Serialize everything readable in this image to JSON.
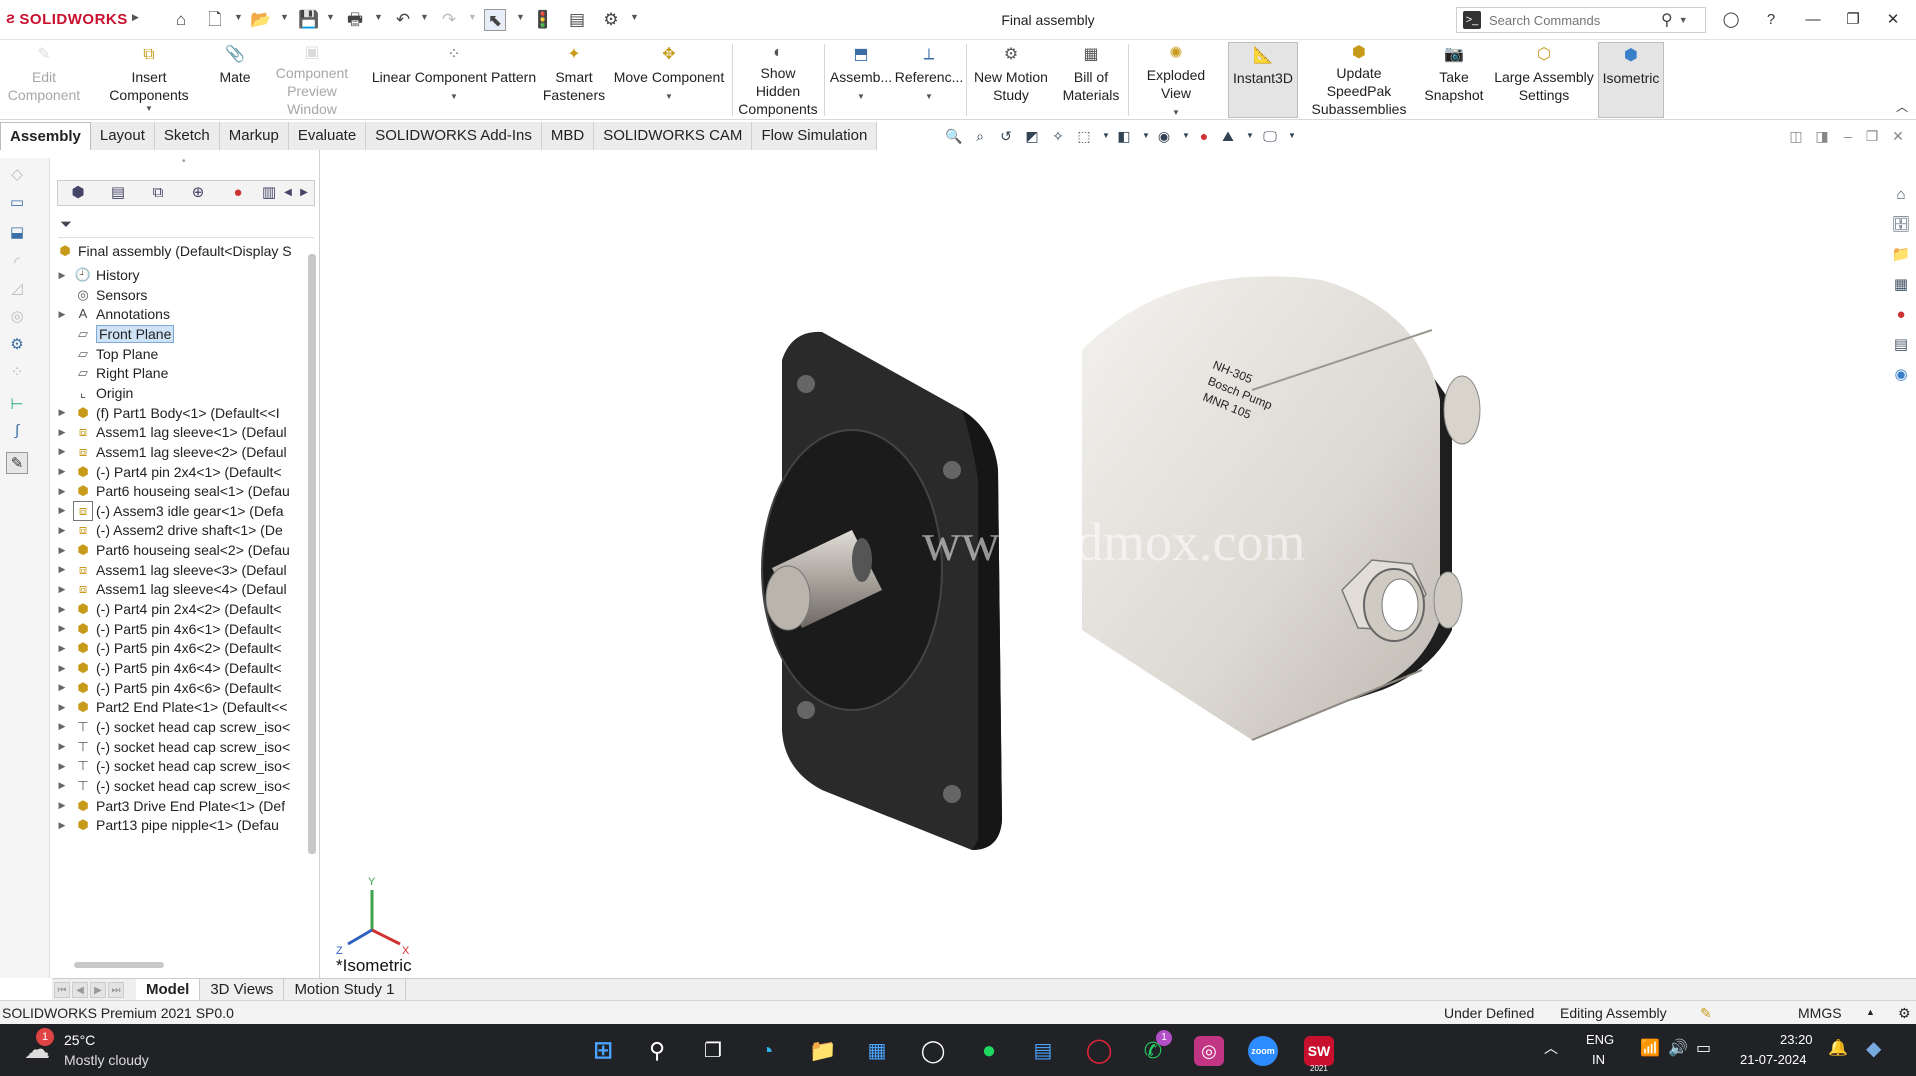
{
  "app": {
    "brand": "SOLIDWORKS",
    "document_title": "Final assembly",
    "search_placeholder": "Search Commands"
  },
  "ribbon": [
    {
      "id": "edit-component",
      "label": "Edit Component",
      "disabled": true
    },
    {
      "id": "insert-components",
      "label": "Insert Components",
      "disabled": false,
      "caret": true
    },
    {
      "id": "mate",
      "label": "Mate",
      "disabled": false
    },
    {
      "id": "component-preview-window",
      "label": "Component Preview Window",
      "disabled": true
    },
    {
      "id": "linear-component-pattern",
      "label": "Linear Component Pattern",
      "disabled": false,
      "caret": true
    },
    {
      "id": "smart-fasteners",
      "label": "Smart Fasteners",
      "disabled": false
    },
    {
      "id": "move-component",
      "label": "Move Component",
      "disabled": false,
      "caret": true
    },
    {
      "id": "show-hidden-components",
      "label": "Show Hidden Components",
      "disabled": false
    },
    {
      "id": "assembly-features",
      "label": "Assemb...",
      "disabled": false,
      "caret": true
    },
    {
      "id": "reference-geometry",
      "label": "Referenc...",
      "disabled": false,
      "caret": true
    },
    {
      "id": "new-motion-study",
      "label": "New Motion Study",
      "disabled": false
    },
    {
      "id": "bill-of-materials",
      "label": "Bill of Materials",
      "disabled": false
    },
    {
      "id": "exploded-view",
      "label": "Exploded View",
      "disabled": false,
      "caret": true
    },
    {
      "id": "instant3d",
      "label": "Instant3D",
      "disabled": false,
      "active": true
    },
    {
      "id": "update-speedpak",
      "label": "Update SpeedPak Subassemblies",
      "disabled": false
    },
    {
      "id": "take-snapshot",
      "label": "Take Snapshot",
      "disabled": false
    },
    {
      "id": "large-assembly-settings",
      "label": "Large Assembly Settings",
      "disabled": false
    },
    {
      "id": "isometric",
      "label": "Isometric",
      "disabled": false,
      "active": true
    }
  ],
  "tabs": [
    "Assembly",
    "Layout",
    "Sketch",
    "Markup",
    "Evaluate",
    "SOLIDWORKS Add-Ins",
    "MBD",
    "SOLIDWORKS CAM",
    "Flow Simulation"
  ],
  "active_tab": "Assembly",
  "tree": {
    "root": "Final assembly  (Default<Display S",
    "items": [
      {
        "label": "History",
        "icon": "history-icon",
        "expandable": true
      },
      {
        "label": "Sensors",
        "icon": "sensor-icon",
        "expandable": false
      },
      {
        "label": "Annotations",
        "icon": "annotation-icon",
        "expandable": true
      },
      {
        "label": "Front Plane",
        "icon": "plane-icon",
        "expandable": false,
        "selected": true
      },
      {
        "label": "Top Plane",
        "icon": "plane-icon",
        "expandable": false
      },
      {
        "label": "Right Plane",
        "icon": "plane-icon",
        "expandable": false
      },
      {
        "label": "Origin",
        "icon": "origin-icon",
        "expandable": false
      },
      {
        "label": "(f) Part1 Body<1> (Default<<I",
        "icon": "part-icon",
        "expandable": true
      },
      {
        "label": "Assem1 lag sleeve<1> (Defaul",
        "icon": "assembly-icon",
        "expandable": true
      },
      {
        "label": "Assem1 lag sleeve<2> (Defaul",
        "icon": "assembly-icon",
        "expandable": true
      },
      {
        "label": "(-) Part4 pin 2x4<1> (Default<",
        "icon": "part-icon",
        "expandable": true
      },
      {
        "label": "Part6 houseing seal<1> (Defau",
        "icon": "part-icon",
        "expandable": true
      },
      {
        "label": "(-) Assem3 idle gear<1> (Defa",
        "icon": "assembly-icon",
        "expandable": true,
        "outlined": true
      },
      {
        "label": "(-) Assem2 drive shaft<1> (De",
        "icon": "assembly-icon",
        "expandable": true
      },
      {
        "label": "Part6 houseing seal<2> (Defau",
        "icon": "part-icon",
        "expandable": true
      },
      {
        "label": "Assem1 lag sleeve<3> (Defaul",
        "icon": "assembly-icon",
        "expandable": true
      },
      {
        "label": "Assem1 lag sleeve<4> (Defaul",
        "icon": "assembly-icon",
        "expandable": true
      },
      {
        "label": "(-) Part4 pin 2x4<2> (Default<",
        "icon": "part-icon",
        "expandable": true
      },
      {
        "label": "(-) Part5 pin 4x6<1> (Default<",
        "icon": "part-icon",
        "expandable": true
      },
      {
        "label": "(-) Part5 pin 4x6<2> (Default<",
        "icon": "part-icon",
        "expandable": true
      },
      {
        "label": "(-) Part5 pin 4x6<4> (Default<",
        "icon": "part-icon",
        "expandable": true
      },
      {
        "label": "(-) Part5 pin 4x6<6> (Default<",
        "icon": "part-icon",
        "expandable": true
      },
      {
        "label": "Part2 End Plate<1> (Default<<",
        "icon": "part-icon",
        "expandable": true
      },
      {
        "label": "(-) socket head cap screw_iso<",
        "icon": "screw-icon",
        "expandable": true
      },
      {
        "label": "(-) socket head cap screw_iso<",
        "icon": "screw-icon",
        "expandable": true
      },
      {
        "label": "(-) socket head cap screw_iso<",
        "icon": "screw-icon",
        "expandable": true
      },
      {
        "label": "(-) socket head cap screw_iso<",
        "icon": "screw-icon",
        "expandable": true
      },
      {
        "label": "Part3 Drive End Plate<1> (Def",
        "icon": "part-icon",
        "expandable": true
      },
      {
        "label": "Part13 pipe nipple<1> (Defau",
        "icon": "part-icon",
        "expandable": true
      }
    ]
  },
  "viewport": {
    "view_name": "*Isometric",
    "watermark": "www.3dmox.com",
    "label_lines": [
      "NH-305",
      "Bosch Pump",
      "MNR 105"
    ],
    "triad": {
      "x": "X",
      "y": "Y",
      "z": "Z"
    }
  },
  "bottom_tabs": [
    "Model",
    "3D Views",
    "Motion Study 1"
  ],
  "active_bottom_tab": "Model",
  "status": {
    "product": "SOLIDWORKS Premium 2021 SP0.0",
    "definition": "Under Defined",
    "mode": "Editing Assembly",
    "units": "MMGS"
  },
  "taskbar": {
    "weather_temp": "25°C",
    "weather_desc": "Mostly cloudy",
    "weather_badge": "1",
    "whatsapp_badge": "1",
    "lang": "ENG",
    "region": "IN",
    "time": "23:20",
    "date": "21-07-2024",
    "sw_version_tag": "2021"
  },
  "colors": {
    "accent": "#c8102e",
    "selection": "#cfe3f7",
    "taskbar": "#202225"
  }
}
